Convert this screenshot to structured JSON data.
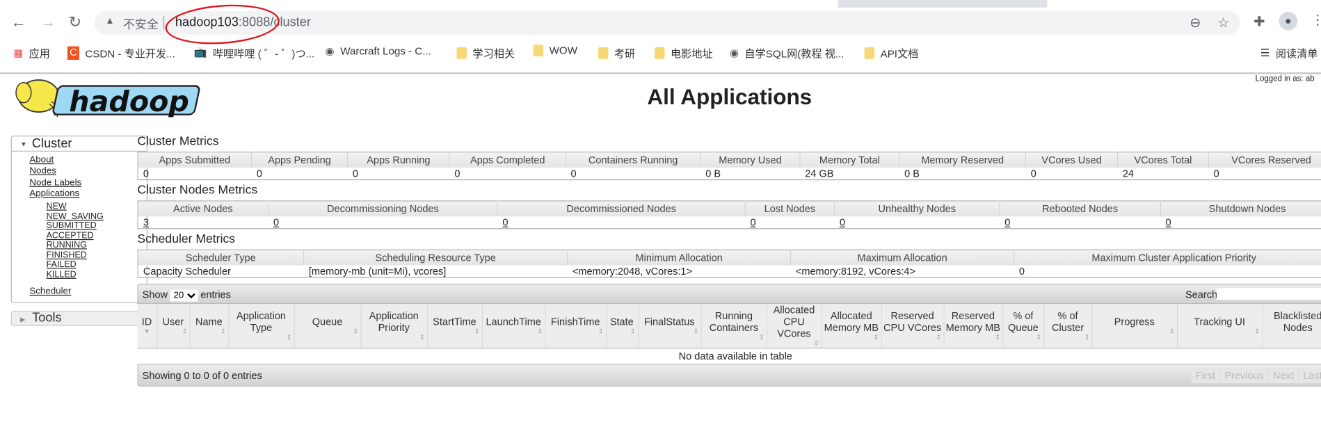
{
  "browser": {
    "insecure_label": "不安全",
    "url_host": "hadoop103",
    "url_port": ":8088",
    "url_path": "/cluster",
    "bookmarks": [
      {
        "label": "应用",
        "icon": "apps-grid-icon"
      },
      {
        "label": "CSDN - 专业开发...",
        "icon": "csdn-icon"
      },
      {
        "label": "哔哩哔哩 ( ゜- ゜)つ...",
        "icon": "bilibili-icon"
      },
      {
        "label": "Warcraft Logs - C...",
        "icon": "globe-icon"
      },
      {
        "label": "学习相关",
        "icon": "folder-icon"
      },
      {
        "label": "WOW",
        "icon": "folder-icon"
      },
      {
        "label": "考研",
        "icon": "folder-icon"
      },
      {
        "label": "电影地址",
        "icon": "folder-icon"
      },
      {
        "label": "自学SQL网(教程 视...",
        "icon": "globe-icon"
      },
      {
        "label": "API文档",
        "icon": "folder-icon"
      }
    ],
    "reading_list": "阅读清单",
    "annotation_color": "#e0141b"
  },
  "header": {
    "logo_text": "hadoop",
    "title": "All Applications",
    "logged_in": "Logged in as: ab"
  },
  "sidebar": {
    "cluster_label": "Cluster",
    "links": [
      "About",
      "Nodes",
      "Node Labels",
      "Applications"
    ],
    "app_states": [
      "NEW",
      "NEW_SAVING",
      "SUBMITTED",
      "ACCEPTED",
      "RUNNING",
      "FINISHED",
      "FAILED",
      "KILLED"
    ],
    "scheduler": "Scheduler",
    "tools_label": "Tools"
  },
  "cluster_metrics": {
    "title": "Cluster Metrics",
    "headers": [
      "Apps Submitted",
      "Apps Pending",
      "Apps Running",
      "Apps Completed",
      "Containers Running",
      "Memory Used",
      "Memory Total",
      "Memory Reserved",
      "VCores Used",
      "VCores Total",
      "VCores Reserved"
    ],
    "values": [
      "0",
      "0",
      "0",
      "0",
      "0",
      "0 B",
      "24 GB",
      "0 B",
      "0",
      "24",
      "0"
    ]
  },
  "nodes_metrics": {
    "title": "Cluster Nodes Metrics",
    "headers": [
      "Active Nodes",
      "Decommissioning Nodes",
      "Decommissioned Nodes",
      "Lost Nodes",
      "Unhealthy Nodes",
      "Rebooted Nodes",
      "Shutdown Nodes"
    ],
    "values": [
      "3",
      "0",
      "0",
      "0",
      "0",
      "0",
      "0"
    ]
  },
  "scheduler_metrics": {
    "title": "Scheduler Metrics",
    "headers": [
      "Scheduler Type",
      "Scheduling Resource Type",
      "Minimum Allocation",
      "Maximum Allocation",
      "Maximum Cluster Application Priority"
    ],
    "values": [
      "Capacity Scheduler",
      "[memory-mb (unit=Mi), vcores]",
      "<memory:2048, vCores:1>",
      "<memory:8192, vCores:4>",
      "0"
    ]
  },
  "apps_table": {
    "show_label": "Show",
    "page_size": "20",
    "entries_label": "entries",
    "search_label": "Search:",
    "search_value": "",
    "columns": [
      "ID",
      "User",
      "Name",
      "Application Type",
      "Queue",
      "Application Priority",
      "StartTime",
      "LaunchTime",
      "FinishTime",
      "State",
      "FinalStatus",
      "Running Containers",
      "Allocated CPU VCores",
      "Allocated Memory MB",
      "Reserved CPU VCores",
      "Reserved Memory MB",
      "% of Queue",
      "% of Cluster",
      "Progress",
      "Tracking UI",
      "Blacklisted Nodes"
    ],
    "empty_message": "No data available in table",
    "info": "Showing 0 to 0 of 0 entries",
    "pagination": [
      "First",
      "Previous",
      "Next",
      "Last"
    ]
  }
}
